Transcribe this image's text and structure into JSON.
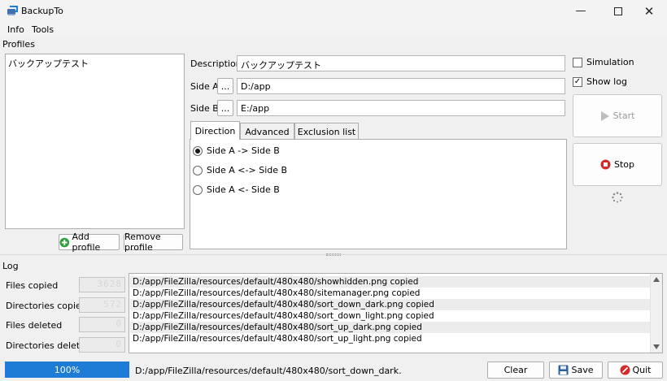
{
  "window": {
    "title": "BackupTo"
  },
  "menu": {
    "info": "Info",
    "tools": "Tools"
  },
  "profiles": {
    "label": "Profiles",
    "items": [
      "バックアップテスト"
    ],
    "add_label": "Add profile",
    "remove_label": "Remove profile"
  },
  "form": {
    "description_label": "Description",
    "description_value": "バックアップテスト",
    "side_a_label": "Side A",
    "side_a_browse": "...",
    "side_a_value": "D:/app",
    "side_b_label": "Side B",
    "side_b_browse": "...",
    "side_b_value": "E:/app"
  },
  "tabs": [
    "Direction",
    "Advanced",
    "Exclusion list"
  ],
  "direction": {
    "options": [
      "Side A -> Side B",
      "Side A <-> Side B",
      "Side A <- Side B"
    ],
    "selected": 0
  },
  "options": {
    "simulation_label": "Simulation",
    "simulation_checked": false,
    "show_log_label": "Show log",
    "show_log_checked": true
  },
  "actions": {
    "start_label": "Start",
    "stop_label": "Stop"
  },
  "log": {
    "label": "Log",
    "counters": [
      {
        "label": "Files copied",
        "value": "3628"
      },
      {
        "label": "Directories copied",
        "value": "572"
      },
      {
        "label": "Files deleted",
        "value": "0"
      },
      {
        "label": "Directories deleted",
        "value": "0"
      }
    ],
    "lines": [
      "D:/app/FileZilla/resources/default/480x480/showhidden.png copied",
      "D:/app/FileZilla/resources/default/480x480/sitemanager.png copied",
      "D:/app/FileZilla/resources/default/480x480/sort_down_dark.png copied",
      "D:/app/FileZilla/resources/default/480x480/sort_down_light.png copied",
      "D:/app/FileZilla/resources/default/480x480/sort_up_dark.png copied",
      "D:/app/FileZilla/resources/default/480x480/sort_up_light.png copied"
    ]
  },
  "status": {
    "progress": 1.0,
    "progress_text": "100%",
    "current_file": "D:/app/FileZilla/resources/default/480x480/sort_down_dark.",
    "clear_label": "Clear",
    "save_label": "Save",
    "quit_label": "Quit"
  },
  "colors": {
    "accent": "#1e7bd6",
    "add_icon": "#2e9e3e",
    "stop_icon": "#d42a2a",
    "quit_icon": "#d42a2a"
  }
}
